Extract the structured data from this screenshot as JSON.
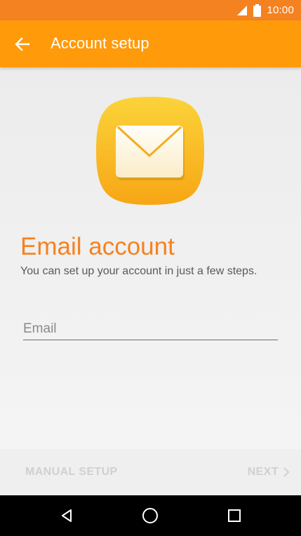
{
  "status_bar": {
    "time": "10:00",
    "icons": [
      "signal-icon",
      "battery-icon"
    ]
  },
  "app_bar": {
    "title": "Account setup",
    "back_icon": "arrow-back-icon"
  },
  "main": {
    "icon": "mail-icon",
    "title": "Email account",
    "subtitle": "You can set up your account in just a few steps.",
    "email_field": {
      "placeholder": "Email",
      "value": ""
    }
  },
  "actions": {
    "manual_setup_label": "MANUAL SETUP",
    "next_label": "NEXT",
    "next_icon": "chevron-right-icon"
  },
  "nav_bar": {
    "buttons": [
      "back-triangle-icon",
      "home-circle-icon",
      "recents-square-icon"
    ]
  },
  "colors": {
    "status_bar": "#f58220",
    "app_bar": "#ff9a0a",
    "title_accent": "#f58220",
    "disabled_text": "#d0d0d0"
  }
}
